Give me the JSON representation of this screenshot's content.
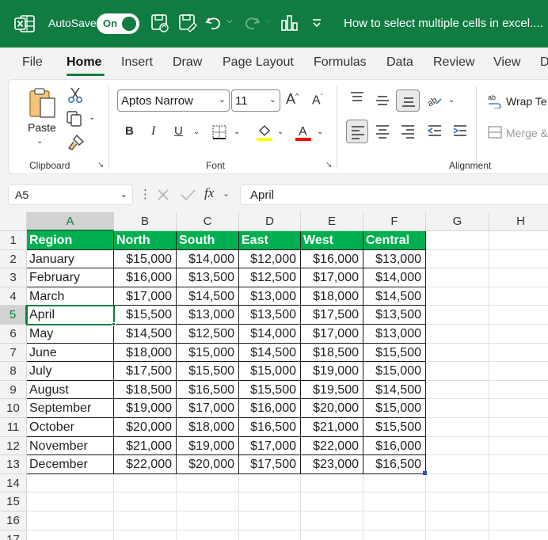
{
  "titlebar": {
    "autosave_label": "AutoSave",
    "autosave_state": "On",
    "title": "How to select multiple cells in excel....",
    "icons": [
      "excel-logo-icon",
      "save-sync-icon",
      "save-icon",
      "undo-icon",
      "redo-icon",
      "chart-icon",
      "customize-toolbar-icon"
    ],
    "accent": "#107c41"
  },
  "menu": {
    "tabs": [
      "File",
      "Home",
      "Insert",
      "Draw",
      "Page Layout",
      "Formulas",
      "Data",
      "Review",
      "View",
      "D"
    ],
    "active": "Home"
  },
  "ribbon": {
    "clipboard": {
      "paste_label": "Paste",
      "group_label": "Clipboard"
    },
    "font": {
      "font_name": "Aptos Narrow",
      "font_size": "11",
      "bold": "B",
      "italic": "I",
      "underline": "U",
      "group_label": "Font",
      "highlight_color": "#ffff00",
      "font_color": "#ff0000"
    },
    "alignment": {
      "wrap_text": "Wrap Te",
      "merge": "Merge &",
      "group_label": "Alignment"
    }
  },
  "formula_bar": {
    "name_box": "A5",
    "fx": "fx",
    "value": "April"
  },
  "sheet": {
    "columns": [
      "A",
      "B",
      "C",
      "D",
      "E",
      "F",
      "G",
      "H"
    ],
    "selected_column": "A",
    "selected_row": "5",
    "header_fill": "#00b050",
    "headers": [
      "Region",
      "North",
      "South",
      "East",
      "West",
      "Central"
    ],
    "rows": [
      [
        "January",
        "$15,000",
        "$14,000",
        "$12,000",
        "$16,000",
        "$13,000"
      ],
      [
        "February",
        "$16,000",
        "$13,500",
        "$12,500",
        "$17,000",
        "$14,000"
      ],
      [
        "March",
        "$17,000",
        "$14,500",
        "$13,000",
        "$18,000",
        "$14,500"
      ],
      [
        "April",
        "$15,500",
        "$13,000",
        "$13,500",
        "$17,500",
        "$13,500"
      ],
      [
        "May",
        "$14,500",
        "$12,500",
        "$14,000",
        "$17,000",
        "$13,000"
      ],
      [
        "June",
        "$18,000",
        "$15,000",
        "$14,500",
        "$18,500",
        "$15,500"
      ],
      [
        "July",
        "$17,500",
        "$15,500",
        "$15,000",
        "$19,000",
        "$15,000"
      ],
      [
        "August",
        "$18,500",
        "$16,500",
        "$15,500",
        "$19,500",
        "$14,500"
      ],
      [
        "September",
        "$19,000",
        "$17,000",
        "$16,000",
        "$20,000",
        "$15,000"
      ],
      [
        "October",
        "$20,000",
        "$18,000",
        "$16,500",
        "$21,000",
        "$15,500"
      ],
      [
        "November",
        "$21,000",
        "$19,000",
        "$17,000",
        "$22,000",
        "$16,000"
      ],
      [
        "December",
        "$22,000",
        "$20,000",
        "$17,500",
        "$23,000",
        "$16,500"
      ]
    ],
    "row_numbers": [
      "1",
      "2",
      "3",
      "4",
      "5",
      "6",
      "7",
      "8",
      "9",
      "10",
      "11",
      "12",
      "13",
      "14",
      "15",
      "16",
      "17"
    ]
  }
}
